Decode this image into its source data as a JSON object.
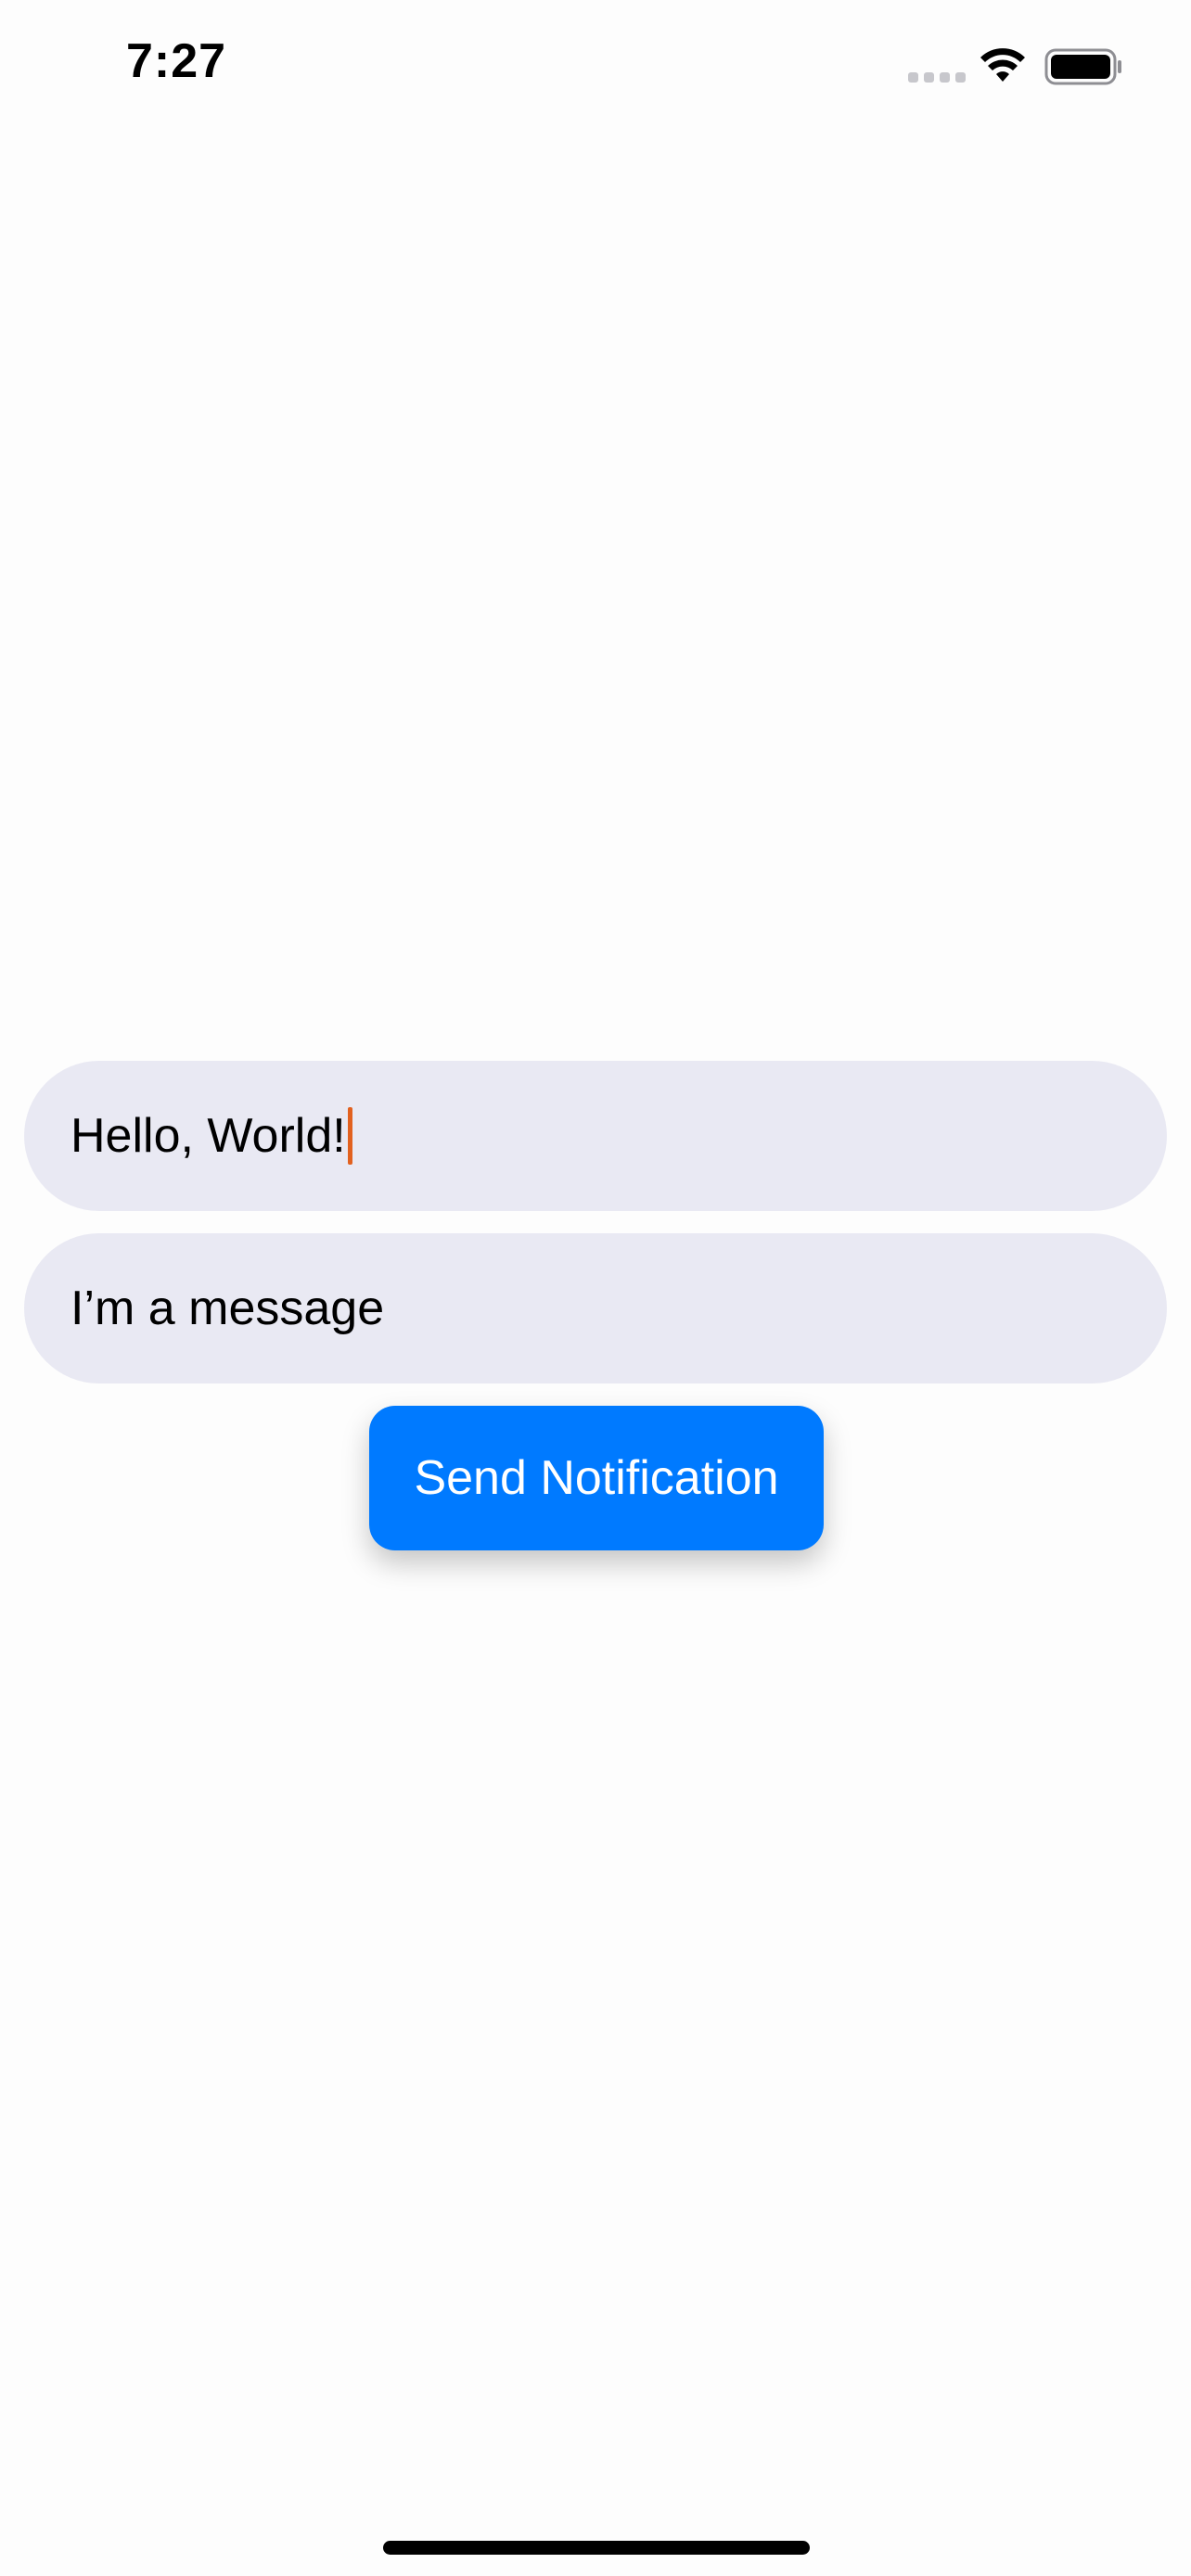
{
  "status_bar": {
    "time": "7:27",
    "icons": [
      "cellular-signal-icon",
      "wifi-icon",
      "battery-icon"
    ]
  },
  "form": {
    "title_field": {
      "value": "Hello, World!",
      "focused": true
    },
    "message_field": {
      "value": "I’m a message"
    },
    "send_button": {
      "label": "Send Notification"
    }
  },
  "colors": {
    "background": "#fdfdfd",
    "field_background": "#e9e9f3",
    "accent_blue": "#007aff",
    "caret": "#e2611f",
    "text": "#000000"
  }
}
